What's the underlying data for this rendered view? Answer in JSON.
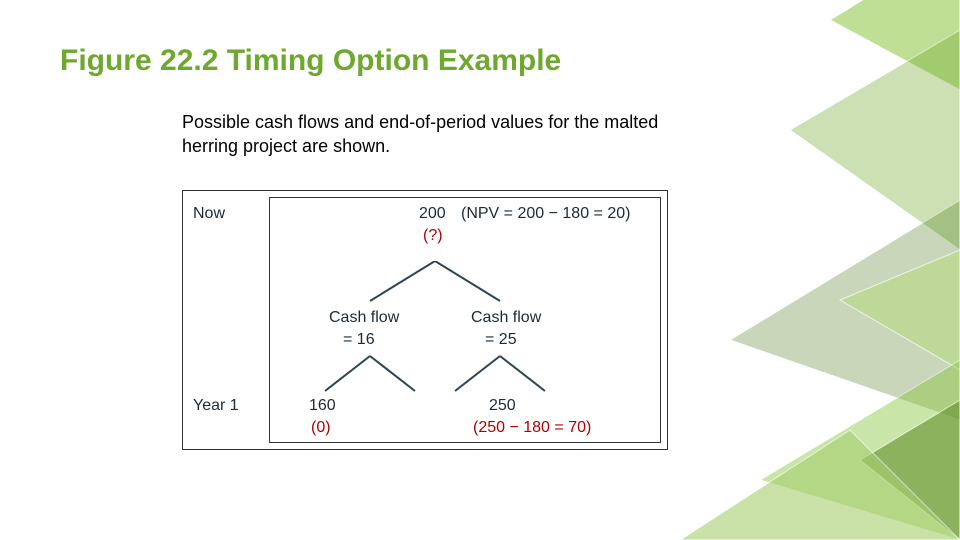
{
  "title": "Figure 22.2 Timing Option Example",
  "subtitle": "Possible cash flows and end-of-period values for the malted herring project are shown.",
  "diagram": {
    "row_now": "Now",
    "row_y1": "Year 1",
    "top_value": "200",
    "top_npv": "(NPV = 200 − 180 = 20)",
    "top_question": "(?)",
    "cf_left_label": "Cash flow",
    "cf_left_value": "= 16",
    "cf_right_label": "Cash flow",
    "cf_right_value": "= 25",
    "leaf_ll": "160",
    "leaf_ll_sub": "(0)",
    "leaf_rr": "250",
    "leaf_rr_sub": "(250 − 180 = 70)"
  }
}
